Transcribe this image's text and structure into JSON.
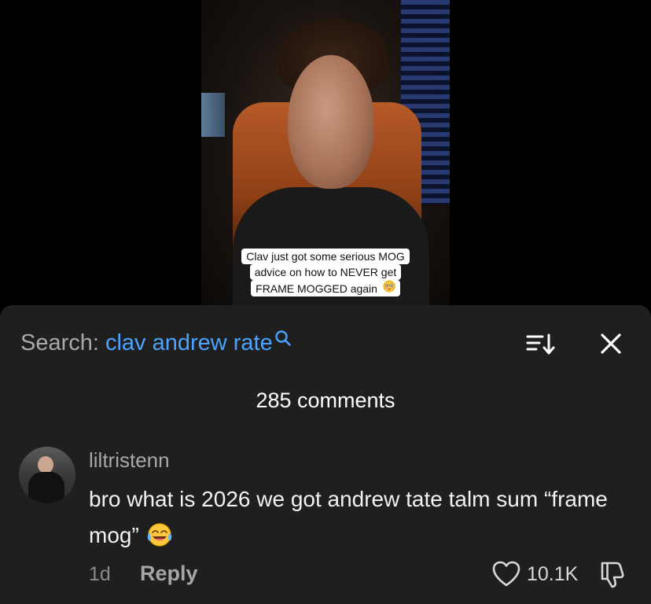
{
  "video": {
    "caption_lines": [
      "Clav just got some serious MOG",
      "advice on how to NEVER get",
      "FRAME MOGGED again"
    ],
    "caption_emoji": "flushed-face-emoji"
  },
  "search": {
    "prefix": "Search:",
    "query": "clav andrew rate"
  },
  "header_icons": [
    "search-icon",
    "sort-icon",
    "close-icon"
  ],
  "comments": {
    "count_label": "285 comments",
    "items": [
      {
        "username": "liltristenn",
        "text": "bro what is 2026 we got andrew tate talm sum “frame mog”",
        "emoji": "tears-of-joy-emoji",
        "time": "1d",
        "reply_label": "Reply",
        "likes": "10.1K"
      }
    ]
  },
  "colors": {
    "accent": "#4aa3ff",
    "sheet_bg": "#1f1f1f",
    "muted_text": "#a8a8a8"
  }
}
